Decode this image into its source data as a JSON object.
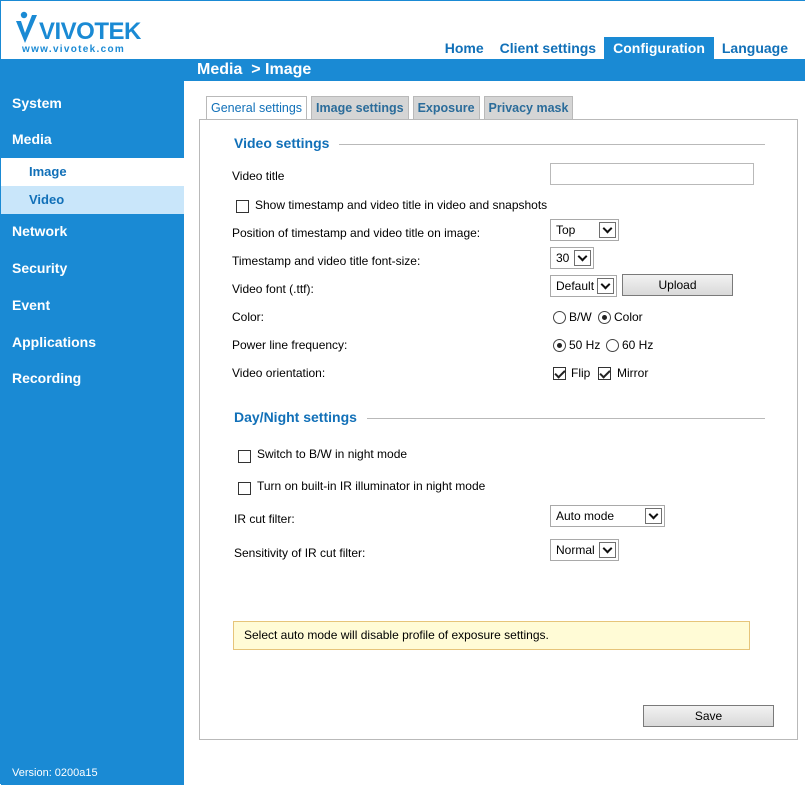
{
  "header": {
    "logo_text": "VIVOTEK",
    "logo_url_text": "www.vivotek.com",
    "nav": [
      {
        "label": "Home"
      },
      {
        "label": "Client settings"
      },
      {
        "label": "Configuration",
        "active": true
      },
      {
        "label": "Language"
      }
    ]
  },
  "page_title": "Media  > Image",
  "sidebar": {
    "items": [
      {
        "label": "System"
      },
      {
        "label": "Media"
      },
      {
        "label": "Image"
      },
      {
        "label": "Video"
      },
      {
        "label": "Network"
      },
      {
        "label": "Security"
      },
      {
        "label": "Event"
      },
      {
        "label": "Applications"
      },
      {
        "label": "Recording"
      }
    ],
    "version": "Version: 0200a15"
  },
  "tabs": [
    {
      "label": "General settings",
      "active": true
    },
    {
      "label": "Image settings"
    },
    {
      "label": "Exposure"
    },
    {
      "label": "Privacy mask"
    }
  ],
  "video_settings": {
    "title": "Video settings",
    "video_title_label": "Video title",
    "video_title_value": "",
    "show_timestamp_label": "Show timestamp and video title in video and snapshots",
    "show_timestamp_checked": false,
    "position_label": "Position of timestamp and video title on image:",
    "position_value": "Top",
    "font_size_label": "Timestamp and video title font-size:",
    "font_size_value": "30",
    "video_font_label": "Video font (.ttf):",
    "video_font_value": "Default",
    "upload_label": "Upload",
    "color_label": "Color:",
    "color_options": [
      "B/W",
      "Color"
    ],
    "color_selected": "Color",
    "power_label": "Power line frequency:",
    "power_options": [
      "50 Hz",
      "60 Hz"
    ],
    "power_selected": "50 Hz",
    "orientation_label": "Video orientation:",
    "flip_label": "Flip",
    "flip_checked": true,
    "mirror_label": "Mirror",
    "mirror_checked": true
  },
  "day_night": {
    "title": "Day/Night settings",
    "bw_night_label": "Switch to B/W in night mode",
    "bw_night_checked": false,
    "ir_illum_label": "Turn on built-in IR illuminator in night mode",
    "ir_illum_checked": false,
    "ir_cut_label": "IR cut filter:",
    "ir_cut_value": "Auto mode",
    "sensitivity_label": "Sensitivity of IR cut filter:",
    "sensitivity_value": "Normal",
    "notice": "Select auto mode will disable profile of exposure settings."
  },
  "save_label": "Save",
  "colors": {
    "brand_blue": "#1a8ad4",
    "link_blue": "#1170b8",
    "notice_bg": "#fffbd6"
  }
}
